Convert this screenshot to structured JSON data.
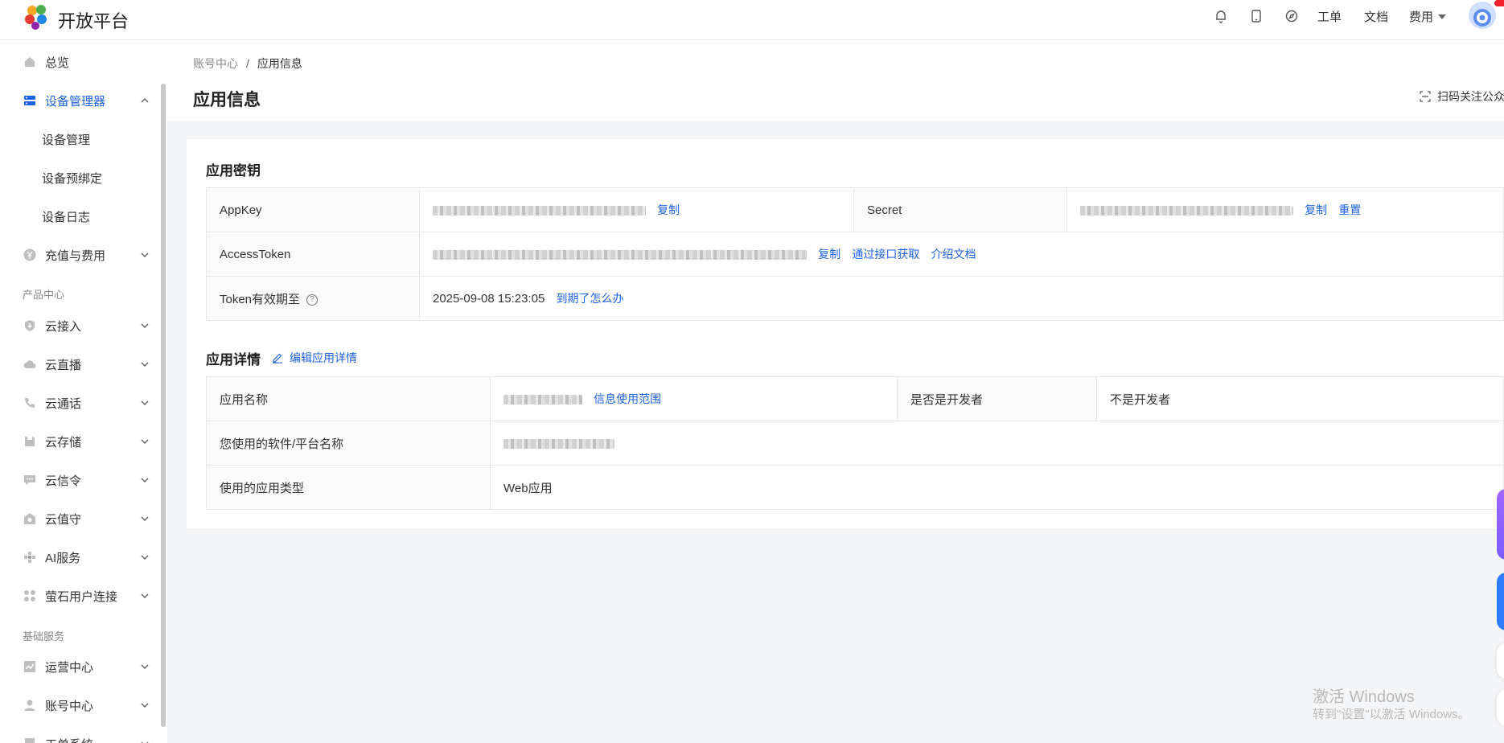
{
  "header": {
    "brand": "开放平台",
    "links": {
      "ticket": "工单",
      "docs": "文档",
      "fees": "费用"
    },
    "icons": [
      "bell-icon",
      "tablet-icon",
      "compass-icon"
    ]
  },
  "sidebar": {
    "overview": "总览",
    "device_mgr": "设备管理器",
    "device_sub": [
      "设备管理",
      "设备预绑定",
      "设备日志"
    ],
    "recharge": "充值与费用",
    "group_product": "产品中心",
    "products": [
      "云接入",
      "云直播",
      "云通话",
      "云存储",
      "云信令",
      "云值守",
      "AI服务",
      "萤石用户连接"
    ],
    "group_basic": "基础服务",
    "basic": [
      "运营中心",
      "账号中心",
      "工单系统"
    ]
  },
  "main": {
    "breadcrumb": {
      "parent": "账号中心",
      "sep": "/",
      "current": "应用信息"
    },
    "title": "应用信息",
    "qr_label": "扫码关注公众",
    "key_section": {
      "title": "应用密钥",
      "appkey_label": "AppKey",
      "secret_label": "Secret",
      "token_label": "AccessToken",
      "expire_label": "Token有效期至",
      "expire_value": "2025-09-08 15:23:05",
      "copy": "复制",
      "reset": "重置",
      "via_api": "通过接口获取",
      "intro_doc": "介绍文档",
      "expired_help": "到期了怎么办"
    },
    "detail_section": {
      "title": "应用详情",
      "edit": "编辑应用详情",
      "name_label": "应用名称",
      "usage_scope": "信息使用范围",
      "dev_label": "是否是开发者",
      "dev_value": "不是开发者",
      "software_label": "您使用的软件/平台名称",
      "type_label": "使用的应用类型",
      "type_value": "Web应用"
    }
  },
  "watermark": {
    "line1": "激活 Windows",
    "line2": "转到\"设置\"以激活 Windows。"
  },
  "colors": {
    "primary": "#1e62e6",
    "bg": "#f4f5f7"
  }
}
